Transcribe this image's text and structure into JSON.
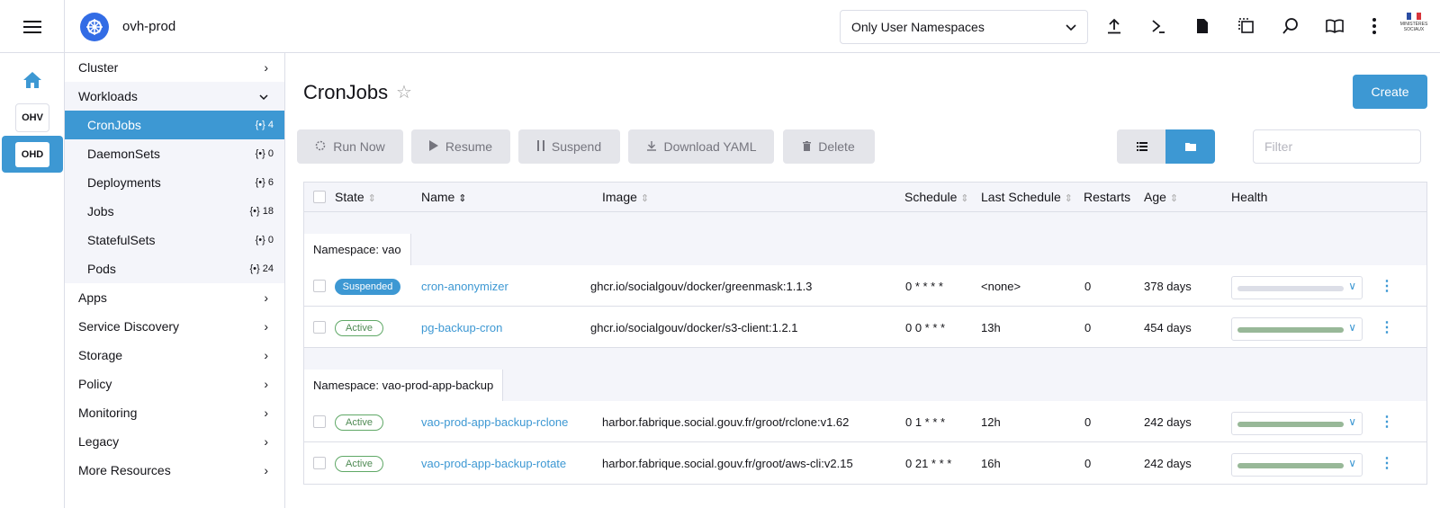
{
  "app": {
    "cluster_name": "ovh-prod",
    "namespace_filter": "Only User Namespaces"
  },
  "rail": {
    "items": [
      {
        "label": "OHV"
      },
      {
        "label": "OHD"
      }
    ]
  },
  "nav": {
    "cluster": "Cluster",
    "workloads": "Workloads",
    "workload_items": [
      {
        "label": "CronJobs",
        "count": "4"
      },
      {
        "label": "DaemonSets",
        "count": "0"
      },
      {
        "label": "Deployments",
        "count": "6"
      },
      {
        "label": "Jobs",
        "count": "18"
      },
      {
        "label": "StatefulSets",
        "count": "0"
      },
      {
        "label": "Pods",
        "count": "24"
      }
    ],
    "groups": [
      "Apps",
      "Service Discovery",
      "Storage",
      "Policy",
      "Monitoring",
      "Legacy",
      "More Resources"
    ]
  },
  "page": {
    "title": "CronJobs",
    "create": "Create",
    "filter_placeholder": "Filter"
  },
  "actions": {
    "run_now": "Run Now",
    "resume": "Resume",
    "suspend": "Suspend",
    "download_yaml": "Download YAML",
    "delete": "Delete"
  },
  "table": {
    "columns": {
      "state": "State",
      "name": "Name",
      "image": "Image",
      "schedule": "Schedule",
      "last_schedule": "Last Schedule",
      "restarts": "Restarts",
      "age": "Age",
      "health": "Health"
    },
    "groups": [
      {
        "label": "Namespace:",
        "namespace": "vao",
        "rows": [
          {
            "state": "Suspended",
            "name": "cron-anonymizer",
            "image": "ghcr.io/socialgouv/docker/greenmask:1.1.3",
            "schedule": "0 * * * *",
            "last_schedule": "<none>",
            "restarts": "0",
            "age": "378 days",
            "health_level": 0
          },
          {
            "state": "Active",
            "name": "pg-backup-cron",
            "image": "ghcr.io/socialgouv/docker/s3-client:1.2.1",
            "schedule": "0 0 * * *",
            "last_schedule": "13h",
            "restarts": "0",
            "age": "454 days",
            "health_level": 1
          }
        ]
      },
      {
        "label": "Namespace:",
        "namespace": "vao-prod-app-backup",
        "rows": [
          {
            "state": "Active",
            "name": "vao-prod-app-backup-rclone",
            "image": "harbor.fabrique.social.gouv.fr/groot/rclone:v1.62",
            "schedule": "0 1 * * *",
            "last_schedule": "12h",
            "restarts": "0",
            "age": "242 days",
            "health_level": 1
          },
          {
            "state": "Active",
            "name": "vao-prod-app-backup-rotate",
            "image": "harbor.fabrique.social.gouv.fr/groot/aws-cli:v2.15",
            "schedule": "0 21 * * *",
            "last_schedule": "16h",
            "restarts": "0",
            "age": "242 days",
            "health_level": 1
          }
        ]
      }
    ]
  },
  "colors": {
    "accent": "#3d98d3",
    "health_ok": "#98b898",
    "health_none": "#dcdee7",
    "active_badge": "#5fa866"
  },
  "icons": {
    "upload": "upload-icon",
    "shell": "terminal-icon",
    "file": "file-icon",
    "copy": "copy-icon",
    "search": "search-icon",
    "book": "book-icon",
    "more": "kebab-icon"
  }
}
